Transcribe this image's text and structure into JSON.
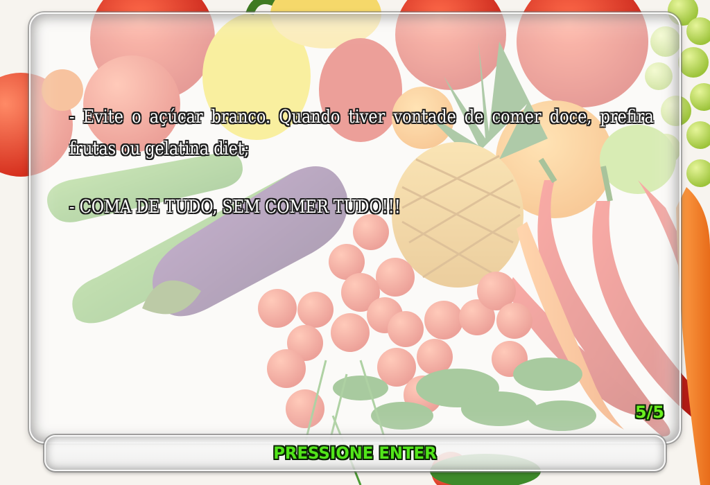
{
  "dialog": {
    "lines": [
      "- Evite o açúcar branco. Quando tiver vontade de comer doce, prefira frutas ou gelatina diet;",
      "- COMA DE TUDO, SEM COMER TUDO!!!"
    ],
    "page_indicator": "5/5"
  },
  "prompt": {
    "label": "PRESSIONE ENTER"
  },
  "background": {
    "icons": [
      "tomato-icon",
      "bell-pepper-icon",
      "apple-icon",
      "grape-icon",
      "pineapple-icon",
      "cucumber-icon",
      "eggplant-icon",
      "cherry-tomato-icon",
      "chili-pepper-icon",
      "carrot-icon",
      "parsley-icon",
      "orange-icon",
      "lime-icon"
    ]
  },
  "colors": {
    "text": "#ffffff",
    "text_outline": "#1c1c1c",
    "accent_green": "#52e51a",
    "panel_tint": "rgba(255,255,255,0.55)"
  }
}
